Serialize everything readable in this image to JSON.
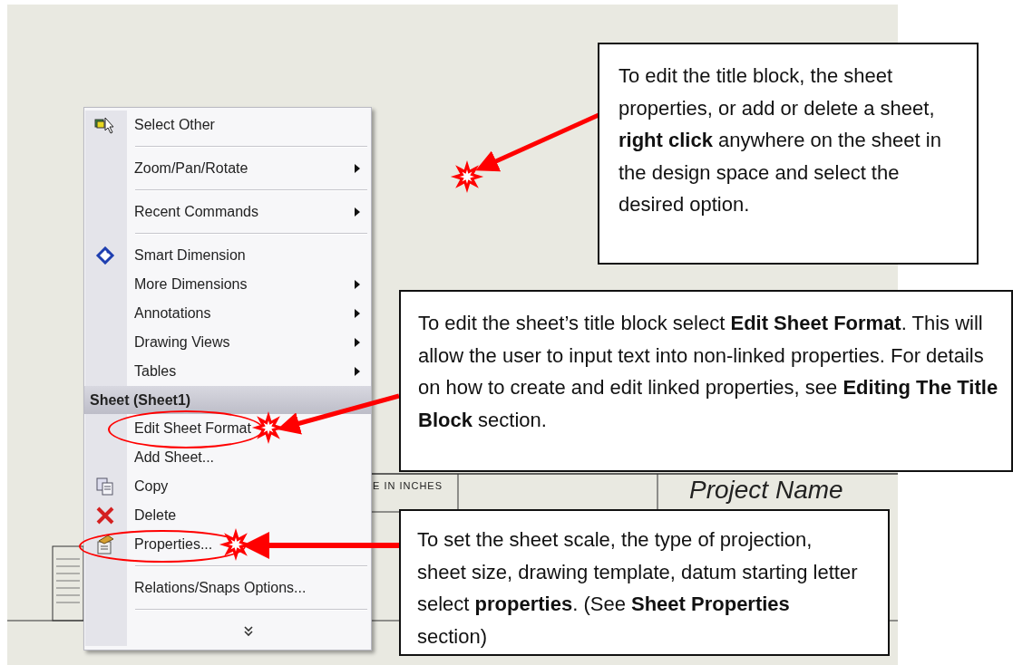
{
  "sheet": {
    "units_note": "E IN INCHES",
    "project_name": "Project Name"
  },
  "menu": {
    "items": [
      {
        "kind": "item",
        "label": "Select Other",
        "submenu": false,
        "circled": false
      },
      {
        "kind": "separator"
      },
      {
        "kind": "item",
        "label": "Zoom/Pan/Rotate",
        "submenu": true,
        "circled": false
      },
      {
        "kind": "separator"
      },
      {
        "kind": "item",
        "label": "Recent Commands",
        "submenu": true,
        "circled": false
      },
      {
        "kind": "separator"
      },
      {
        "kind": "item",
        "label": "Smart Dimension",
        "submenu": false,
        "circled": false
      },
      {
        "kind": "item",
        "label": "More Dimensions",
        "submenu": true,
        "circled": false
      },
      {
        "kind": "item",
        "label": "Annotations",
        "submenu": true,
        "circled": false
      },
      {
        "kind": "item",
        "label": "Drawing Views",
        "submenu": true,
        "circled": false
      },
      {
        "kind": "item",
        "label": "Tables",
        "submenu": true,
        "circled": false
      },
      {
        "kind": "header",
        "label": "Sheet (Sheet1)"
      },
      {
        "kind": "item",
        "label": "Edit Sheet Format",
        "submenu": false,
        "circled": true
      },
      {
        "kind": "item",
        "label": "Add Sheet...",
        "submenu": false,
        "circled": false
      },
      {
        "kind": "item",
        "label": "Copy",
        "submenu": false,
        "circled": false
      },
      {
        "kind": "item",
        "label": "Delete",
        "submenu": false,
        "circled": false
      },
      {
        "kind": "item",
        "label": "Properties...",
        "submenu": false,
        "circled": true
      },
      {
        "kind": "separator"
      },
      {
        "kind": "item",
        "label": "Relations/Snaps Options...",
        "submenu": false,
        "circled": false
      },
      {
        "kind": "separator"
      },
      {
        "kind": "expand"
      }
    ]
  },
  "callouts": [
    {
      "text": "To edit the title block, the sheet properties, or add or delete a sheet, **right click** anywhere on the sheet in the design space and select the desired option."
    },
    {
      "text": "To edit the sheet’s title block select **Edit Sheet Format**. This will allow the user to input text into non-linked properties. For details on how to create and edit linked properties, see **Editing The Title Block** section."
    },
    {
      "text": "To set the sheet scale, the type of projection, sheet size, drawing template, datum starting letter select **properties**. (See **Sheet Properties** section)"
    }
  ]
}
